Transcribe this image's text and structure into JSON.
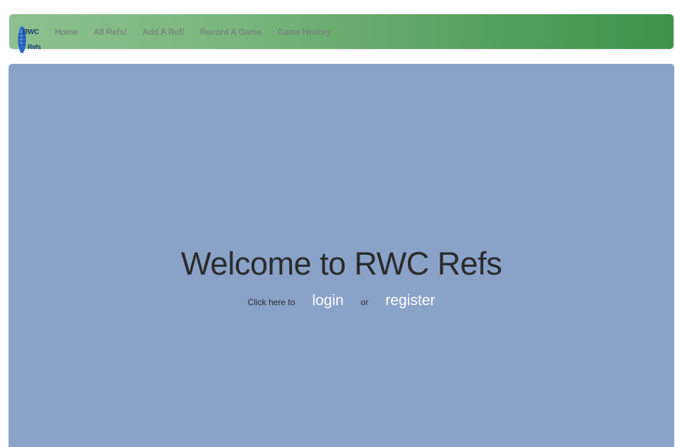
{
  "brand": {
    "logo_line1": "RWC",
    "logo_line2": "Refs",
    "colors": {
      "navbar_start": "#8dc18f",
      "navbar_end": "#3d934a",
      "hero_background": "#8aa2c8",
      "logo_blue": "#2a66c9"
    }
  },
  "nav": {
    "items": [
      {
        "label": "Home"
      },
      {
        "label": "All Refs!"
      },
      {
        "label": "Add A Ref!"
      },
      {
        "label": "Record A Game"
      },
      {
        "label": "Game History"
      }
    ]
  },
  "hero": {
    "title": "Welcome to RWC Refs",
    "prompt": "Click here to",
    "login_label": "login",
    "or_label": "or",
    "register_label": "register"
  },
  "icons": {
    "logo": "rugby-ball-logo-icon"
  }
}
